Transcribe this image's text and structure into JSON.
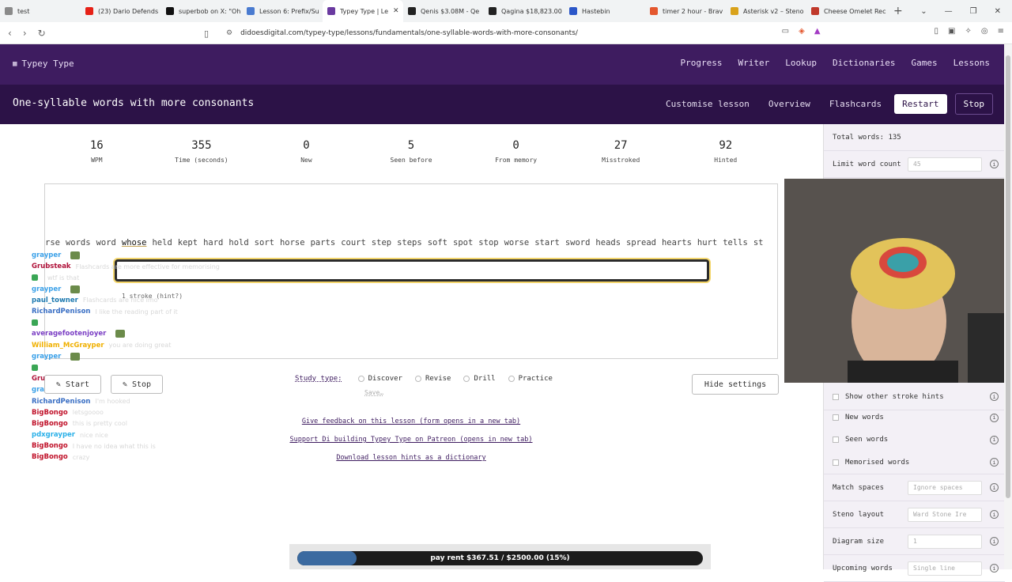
{
  "browser": {
    "tabs": [
      {
        "title": "test",
        "color": "#8a8a8a"
      },
      {
        "title": "(23) Dario Defends",
        "color": "#e62117"
      },
      {
        "title": "superbob on X: \"Oh",
        "color": "#111111"
      },
      {
        "title": "Lesson 6: Prefix/Su",
        "color": "#4a7bd0"
      },
      {
        "title": "Typey Type | Le",
        "color": "#6a3aa0",
        "active": true
      },
      {
        "title": "Qenis $3.08M - Qe",
        "color": "#222222"
      },
      {
        "title": "Qagina $18,823.00",
        "color": "#222222"
      },
      {
        "title": "Hastebin",
        "color": "#2b56c8"
      },
      {
        "title": "timer 2 hour - Brav",
        "color": "#e4572e"
      },
      {
        "title": "Asterisk v2 – Steno",
        "color": "#d9a21b"
      },
      {
        "title": "Cheese Omelet Rec",
        "color": "#c0392b"
      }
    ],
    "url": "didoesdigital.com/typey-type/lessons/fundamentals/one-syllable-words-with-more-consonants/"
  },
  "site": {
    "brand": "Typey Type",
    "nav": [
      "Progress",
      "Writer",
      "Lookup",
      "Dictionaries",
      "Games",
      "Lessons"
    ],
    "lesson_title": "One-syllable words with more consonants",
    "lesson_nav": {
      "customise": "Customise lesson",
      "overview": "Overview",
      "flashcards": "Flashcards",
      "restart": "Restart",
      "stop": "Stop"
    }
  },
  "stats": [
    {
      "value": "16",
      "label": "WPM"
    },
    {
      "value": "355",
      "label": "Time (seconds)"
    },
    {
      "value": "0",
      "label": "New"
    },
    {
      "value": "5",
      "label": "Seen before"
    },
    {
      "value": "0",
      "label": "From memory"
    },
    {
      "value": "27",
      "label": "Misstroked"
    },
    {
      "value": "92",
      "label": "Hinted"
    }
  ],
  "typing": {
    "words_before": [
      "rse",
      "words",
      "word"
    ],
    "current_word": "whose",
    "words_after": [
      "held",
      "kept",
      "hard",
      "hold",
      "sort",
      "horse",
      "parts",
      "court",
      "step",
      "steps",
      "soft",
      "spot",
      "stop",
      "worse",
      "start",
      "sword",
      "heads",
      "spread",
      "hearts",
      "hurt",
      "tells",
      "st"
    ],
    "hint": "1 stroke (hint?)"
  },
  "chat": [
    {
      "user": "grayper",
      "color": "#3aa0e8",
      "text": ""
    },
    {
      "user": "Grubsteak",
      "color": "#b0123a",
      "text": "Flashcards are more effective for memorising"
    },
    {
      "user": "",
      "color": "#3aa0e8",
      "text": "wtf is that"
    },
    {
      "user": "grayper",
      "color": "#3aa0e8",
      "text": ""
    },
    {
      "user": "paul_towner",
      "color": "#1f7ab0",
      "text": "Flashcards are nice imo"
    },
    {
      "user": "RichardPenison",
      "color": "#3a6fc4",
      "text": "I like the reading part of it"
    },
    {
      "user": "",
      "color": "#3a6fc4",
      "text": ""
    },
    {
      "user": "averagefootenjoyer",
      "color": "#7b3fc4",
      "text": ""
    },
    {
      "user": "William_McGrayper",
      "color": "#f0b000",
      "text": "you are doing great"
    },
    {
      "user": "grayper",
      "color": "#3aa0e8",
      "text": ""
    },
    {
      "user": "",
      "color": "#3aa0e8",
      "text": ""
    },
    {
      "user": "Grubsteak",
      "color": "#b0123a",
      "text": ""
    },
    {
      "user": "grayper",
      "color": "#3aa0e8",
      "text": ""
    },
    {
      "user": "RichardPenison",
      "color": "#3a6fc4",
      "text": "I'm hooked"
    },
    {
      "user": "BigBongo",
      "color": "#c0122a",
      "text": "letsgoooo"
    },
    {
      "user": "BigBongo",
      "color": "#c0122a",
      "text": "this is pretty cool"
    },
    {
      "user": "pdxgrayper",
      "color": "#2ab0e8",
      "text": "nice nice"
    },
    {
      "user": "BigBongo",
      "color": "#c0122a",
      "text": "I have no idea what this is"
    },
    {
      "user": "BigBongo",
      "color": "#c0122a",
      "text": "crazy"
    }
  ],
  "controls": {
    "start": "Start",
    "stop": "Stop",
    "study_type_label": "Study type:",
    "study_types": [
      "Discover",
      "Revise",
      "Drill",
      "Practice"
    ],
    "save": "Save…",
    "hide_settings": "Hide settings"
  },
  "links": [
    "Give feedback on this lesson (form opens in a new tab)",
    "Support Di building Typey Type on Patreon (opens in new tab)",
    "Download lesson hints as a dictionary"
  ],
  "settings": {
    "total_words": "Total words: 135",
    "limit_word_count": {
      "label": "Limit word count",
      "value": "45"
    },
    "show_other_stroke_hints": "Show other stroke hints",
    "new_words": "New words",
    "seen_words": "Seen words",
    "memorised_words": "Memorised words",
    "match_spaces": {
      "label": "Match spaces",
      "value": "Ignore spaces"
    },
    "steno_layout": {
      "label": "Steno layout",
      "value": "Ward Stone Ire"
    },
    "diagram_size": {
      "label": "Diagram size",
      "value": "1"
    },
    "upcoming_words": {
      "label": "Upcoming words",
      "value": "Single line"
    }
  },
  "goal": {
    "text": "pay rent $367.51 / $2500.00 (15%)",
    "progress_fraction": 0.147
  }
}
